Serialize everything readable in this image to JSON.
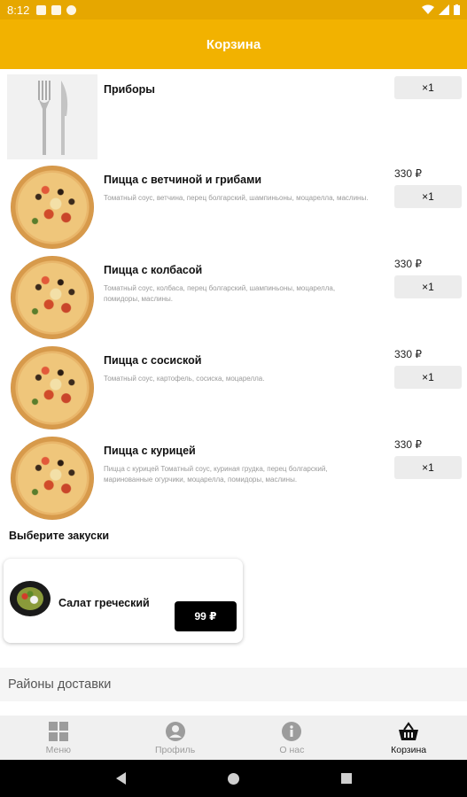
{
  "status_bar": {
    "time": "8:12"
  },
  "app_bar": {
    "title": "Корзина"
  },
  "cart_items": [
    {
      "name": "Приборы",
      "description": "",
      "price": "",
      "qty": "×1",
      "image": "cutlery-icon"
    },
    {
      "name": "Пицца с ветчиной и грибами",
      "description": "Томатный соус, ветчина, перец болгарский, шампиньоны, моцарелла, маслины.",
      "price": "330 ₽",
      "qty": "×1"
    },
    {
      "name": "Пицца с колбасой",
      "description": "Томатный соус, колбаса, перец болгарский, шампиньоны, моцарелла, помидоры, маслины.",
      "price": "330 ₽",
      "qty": "×1"
    },
    {
      "name": "Пицца с сосиской",
      "description": "Томатный соус, картофель, сосиска, моцарелла.",
      "price": "330 ₽",
      "qty": "×1"
    },
    {
      "name": "Пицца с курицей",
      "description": "Пицца с курицей Томатный соус, куриная грудка, перец болгарский, маринованные огурчики, моцарелла, помидоры, маслины.",
      "price": "330 ₽",
      "qty": "×1"
    }
  ],
  "snacks": {
    "section_title": "Выберите закуски",
    "items": [
      {
        "name": "Салат греческий",
        "price": "99 ₽"
      }
    ]
  },
  "delivery": {
    "title": "Районы доставки"
  },
  "bottom_nav": [
    {
      "label": "Меню",
      "icon": "grid-icon",
      "active": false
    },
    {
      "label": "Профиль",
      "icon": "profile-icon",
      "active": false
    },
    {
      "label": "О нас",
      "icon": "info-icon",
      "active": false
    },
    {
      "label": "Корзина",
      "icon": "basket-icon",
      "active": true
    }
  ],
  "colors": {
    "status_bar": "#e6a700",
    "app_bar": "#f2b200",
    "qty_button": "#ececec",
    "price_button": "#000000"
  }
}
